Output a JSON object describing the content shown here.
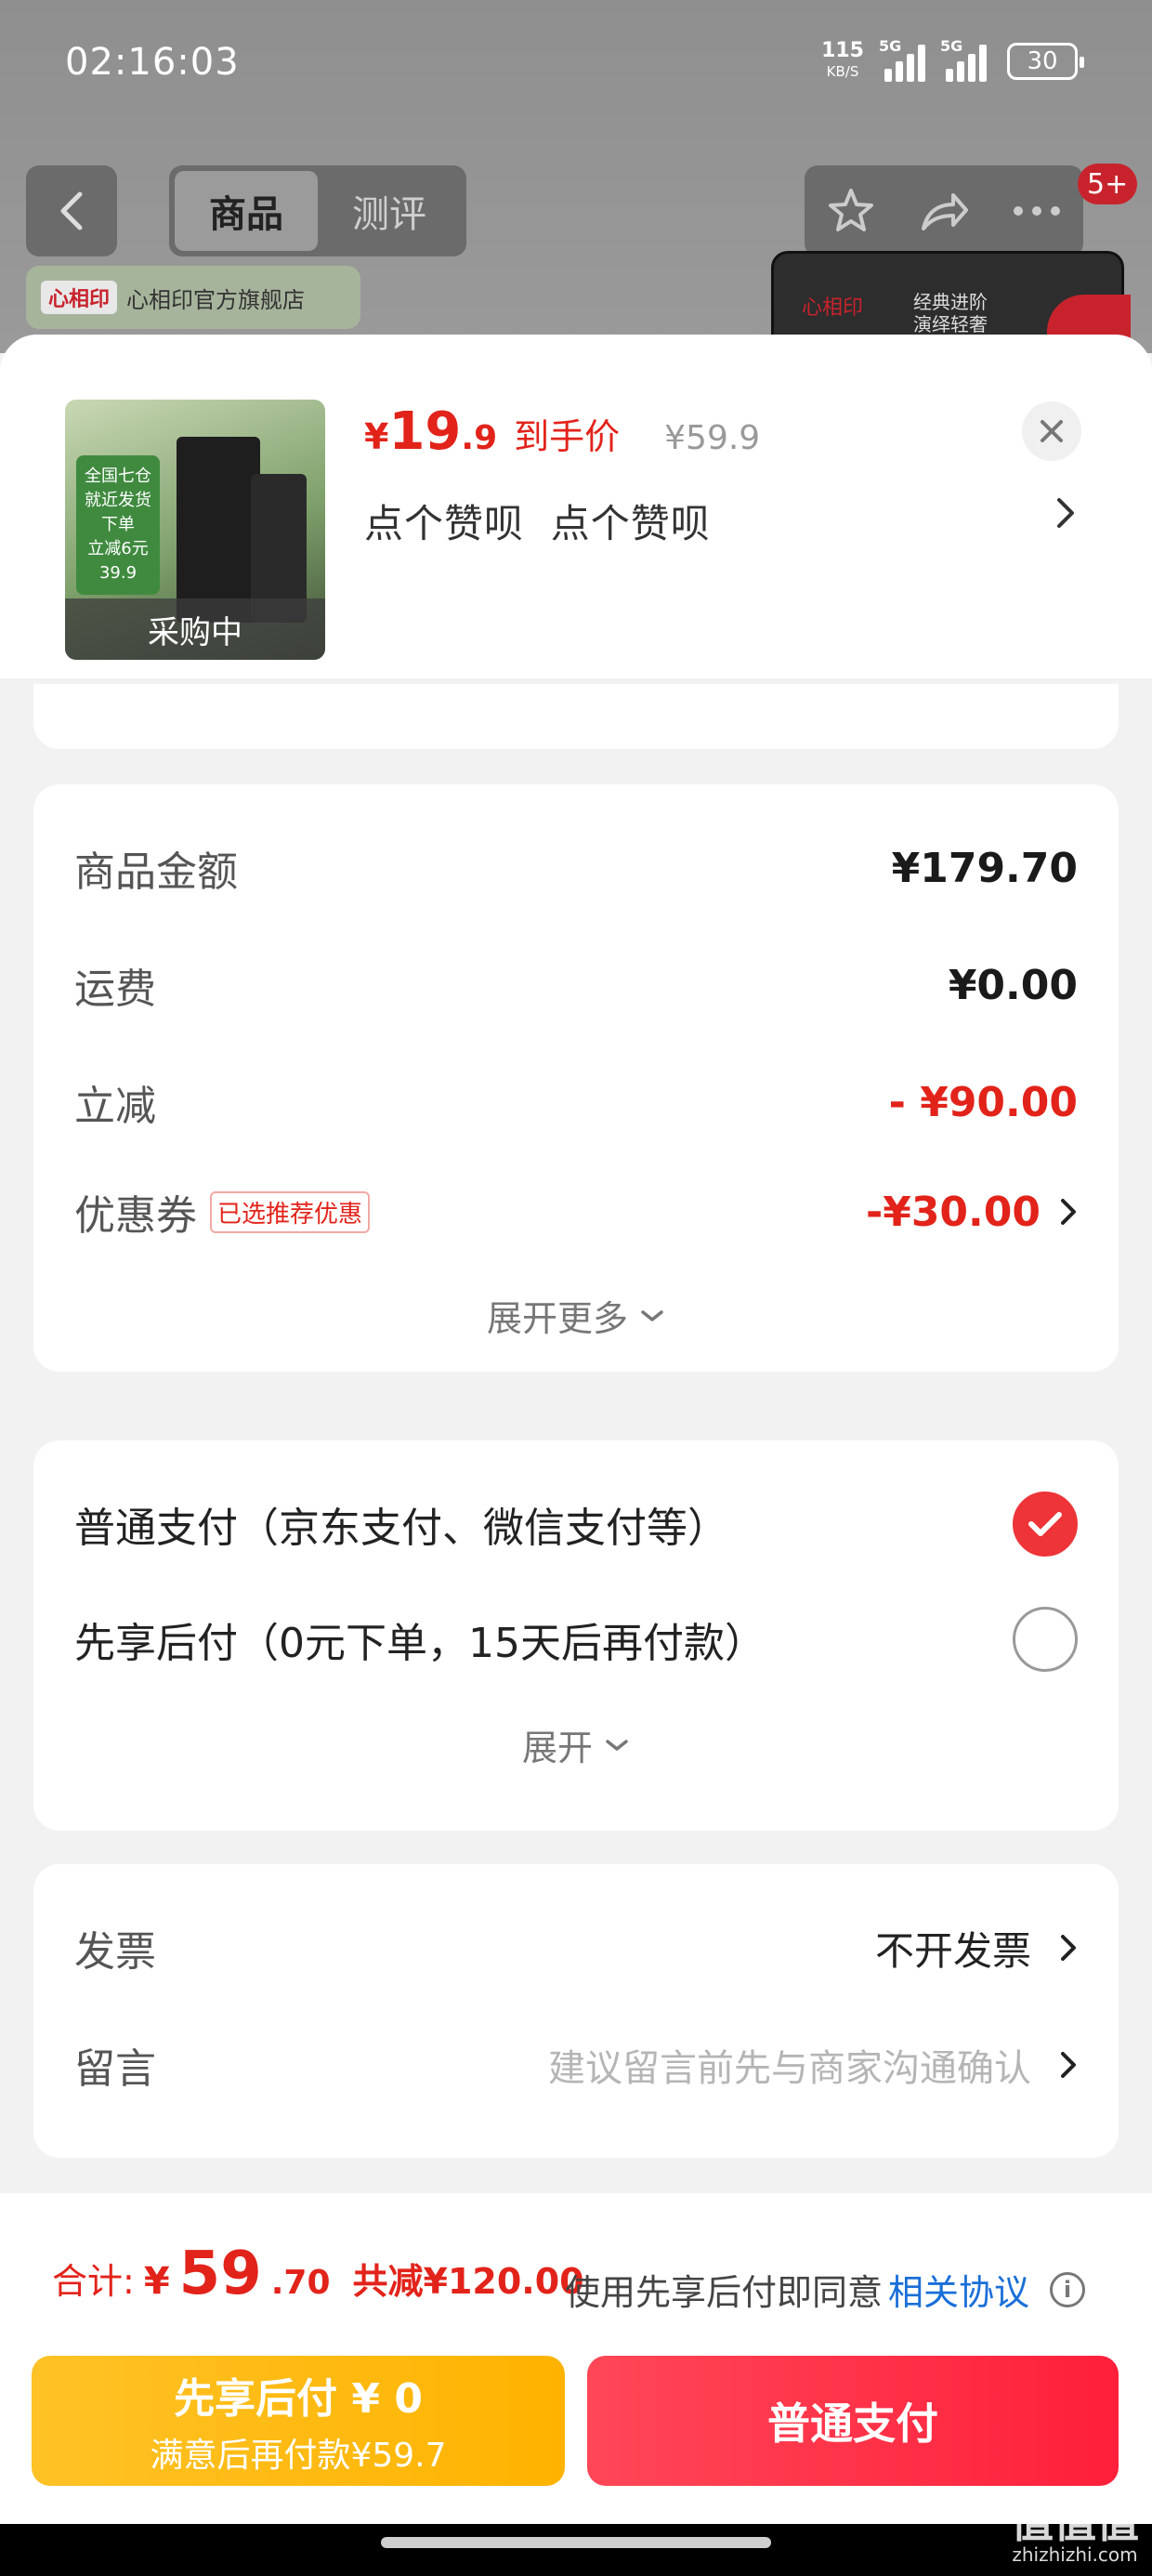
{
  "status_bar": {
    "time": "02:16:03",
    "net_speed": "115",
    "net_unit": "KB/S",
    "sig1": "5G",
    "sig2": "5G",
    "battery": "30"
  },
  "top_nav": {
    "tabs": [
      {
        "label": "商品",
        "active": true
      },
      {
        "label": "测评",
        "active": false
      }
    ],
    "badge": "5+",
    "store_name": "心相印官方旗舰店",
    "store_logo": "心相印",
    "promo_logo": "心相印",
    "promo_text_1": "经典进阶",
    "promo_text_2": "演绎轻奢"
  },
  "product": {
    "price_symbol": "¥",
    "price_int": "19",
    "price_dec": ".9",
    "price_label": "到手价",
    "original_price": "¥59.9",
    "spec": "点个赞呗  点个赞呗",
    "thumb_status": "采购中",
    "thumb_tag": "全国七仓\n就近发货\n下单\n立减6元\n39.9"
  },
  "amounts": {
    "rows": [
      {
        "label": "商品金额",
        "value": "¥179.70"
      },
      {
        "label": "运费",
        "value": "¥0.00"
      },
      {
        "label": "立减",
        "value": "- ¥90.00"
      },
      {
        "label": "优惠券",
        "value": "-¥30.00",
        "tag": "已选推荐优惠"
      }
    ],
    "expand_label": "展开更多"
  },
  "payment": {
    "options": [
      {
        "label": "普通支付（京东支付、微信支付等）",
        "checked": true
      },
      {
        "label": "先享后付（0元下单，15天后再付款）",
        "checked": false
      }
    ],
    "expand_label": "展开"
  },
  "extras": {
    "invoice_label": "发票",
    "invoice_value": "不开发票",
    "note_label": "留言",
    "note_placeholder": "建议留言前先与商家沟通确认"
  },
  "footer": {
    "total_label": "合计:",
    "total_yen": "¥",
    "total_int": "59",
    "total_dec": ".70",
    "total_saved": "共减¥120.00",
    "agree_text": "使用先享后付即同意",
    "agree_link": "相关协议",
    "bnpl_title": "先享后付 ¥ 0",
    "bnpl_sub": "满意后再付款¥59.7",
    "pay_button": "普通支付"
  },
  "watermark": {
    "main": "值值值",
    "sub": "zhizhizhi.com"
  },
  "colors": {
    "accent_red": "#e2231a",
    "bnpl_yellow": "#ffb300",
    "link_blue": "#1a6fd8"
  }
}
